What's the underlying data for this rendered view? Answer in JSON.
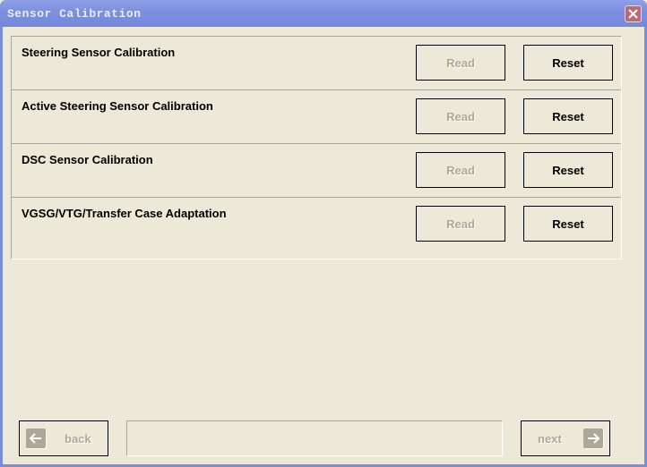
{
  "window": {
    "title": "Sensor Calibration",
    "close_icon": "close-icon"
  },
  "rows": [
    {
      "label": "Steering Sensor Calibration",
      "read_label": "Read",
      "reset_label": "Reset",
      "read_enabled": false
    },
    {
      "label": "Active Steering Sensor Calibration",
      "read_label": "Read",
      "reset_label": "Reset",
      "read_enabled": false
    },
    {
      "label": "DSC Sensor Calibration",
      "read_label": "Read",
      "reset_label": "Reset",
      "read_enabled": false
    },
    {
      "label": "VGSG/VTG/Transfer Case Adaptation",
      "read_label": "Read",
      "reset_label": "Reset",
      "read_enabled": false
    }
  ],
  "footer": {
    "back_label": "back",
    "next_label": "next",
    "status_text": "",
    "back_icon": "arrow-left-icon",
    "next_icon": "arrow-right-icon"
  },
  "colors": {
    "titlebar": "#7d90e0",
    "window_bg": "#ece9d8",
    "disabled_text": "#aca899",
    "close_button": "#b96a78"
  }
}
